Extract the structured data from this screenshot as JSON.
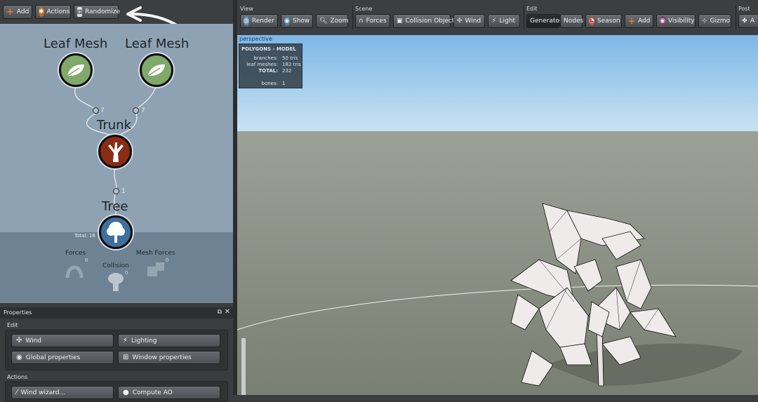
{
  "left_toolbar": {
    "buttons": [
      {
        "label": "Add",
        "icon": "plus-icon"
      },
      {
        "label": "Actions",
        "icon": "gear-icon"
      },
      {
        "label": "Randomize",
        "icon": "dice-icon"
      }
    ]
  },
  "graph": {
    "nodes": [
      {
        "label": "Leaf Mesh",
        "icon": "leaf-icon",
        "color": "#7fa86a",
        "port_count": "7"
      },
      {
        "label": "Leaf Mesh",
        "icon": "leaf-icon",
        "color": "#7fa86a",
        "port_count": "7"
      },
      {
        "label": "Trunk",
        "icon": "trunk-icon",
        "color": "#8a2b14",
        "port_count": "1"
      },
      {
        "label": "Tree",
        "icon": "tree-icon",
        "color": "#3f6f9e",
        "total": "Total: 16"
      }
    ],
    "generators": [
      {
        "label": "Forces",
        "count": "0"
      },
      {
        "label": "Mesh Forces",
        "count": "0"
      },
      {
        "label": "Collision",
        "count": "0"
      }
    ]
  },
  "properties": {
    "title": "Properties",
    "edit_label": "Edit",
    "edit_buttons": [
      "Wind",
      "Lighting",
      "Global properties",
      "Window properties"
    ],
    "actions_label": "Actions",
    "action_buttons": [
      "Wind wizard...",
      "Compute AO"
    ]
  },
  "top_toolbar": {
    "view": {
      "label": "View",
      "buttons": [
        "Render",
        "Show",
        "Zoom"
      ]
    },
    "scene": {
      "label": "Scene",
      "buttons": [
        "Forces",
        "Collision Objects",
        "Wind",
        "Light"
      ]
    },
    "edit": {
      "label": "Edit",
      "buttons": [
        "Generators",
        "Nodes",
        "Season",
        "Add",
        "Visibility",
        "Gizmo"
      ]
    },
    "post": {
      "label": "Post",
      "buttons": [
        "A"
      ]
    }
  },
  "viewport": {
    "mode": "perspective",
    "hud": {
      "title": "POLYGONS - MODEL",
      "branches_label": "branches:",
      "branches_value": "50 tris",
      "leaf_label": "leaf meshes:",
      "leaf_value": "182 tris",
      "total_label": "TOTAL:",
      "total_value": "232",
      "bones_label": "bones:",
      "bones_value": "1"
    }
  },
  "colors": {
    "sky_top": "#7cb7e6",
    "sky_bottom": "#c9e2f2",
    "ground": "#8a8f82",
    "graph_bg": "#8ea2b4"
  }
}
